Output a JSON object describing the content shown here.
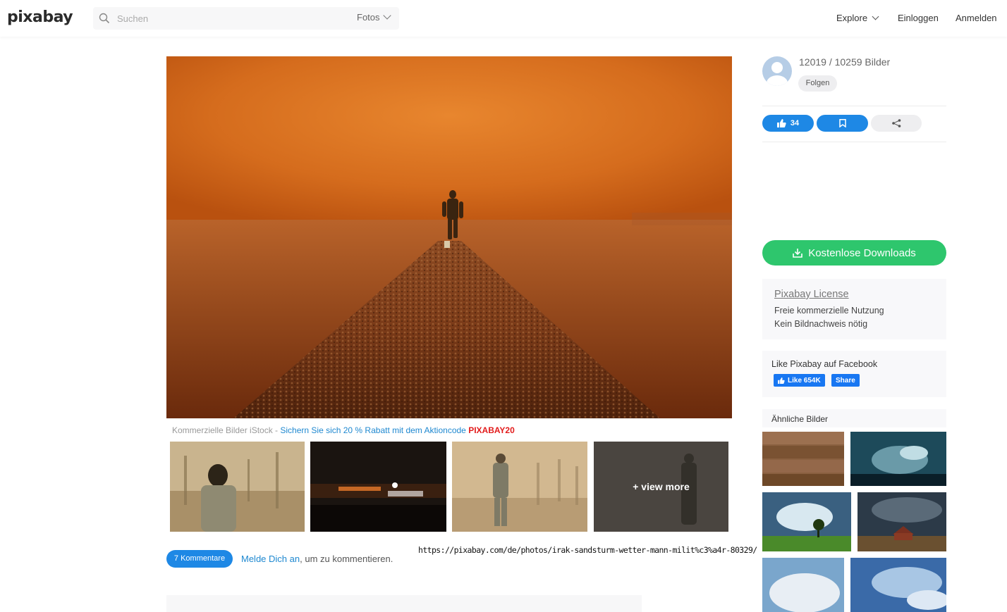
{
  "header": {
    "logo": "pixabay",
    "search_placeholder": "Suchen",
    "media_type": "Fotos",
    "nav": {
      "explore": "Explore",
      "login": "Einloggen",
      "register": "Anmelden"
    }
  },
  "istock": {
    "prefix": "Kommerzielle Bilder iStock - ",
    "promo": "Sichern Sie sich 20 % Rabatt mit dem Aktioncode ",
    "code": "PIXABAY20"
  },
  "related": {
    "view_more": "+ view more"
  },
  "comments": {
    "button": "7 Kommentare",
    "login_link": "Melde Dich an",
    "suffix": ", um zu kommentieren."
  },
  "url_text": "https://pixabay.com/de/photos/irak-sandsturm-wetter-mann-milit%c3%a4r-80329/",
  "sidebar": {
    "user_stats": "12019 / 10259 Bilder",
    "follow": "Folgen",
    "likes": "34",
    "download": "Kostenlose Downloads",
    "license": {
      "title": "Pixabay License",
      "line1": "Freie kommerzielle Nutzung",
      "line2": "Kein Bildnachweis nötig"
    },
    "facebook": {
      "title": "Like Pixabay auf Facebook",
      "like": "Like 654K",
      "share": "Share"
    },
    "similar_title": "Ähnliche Bilder"
  },
  "colors": {
    "accent_blue": "#1e88e5",
    "download_green": "#2ec66d",
    "promo_red": "#e21b1b",
    "facebook_blue": "#1877f2"
  }
}
